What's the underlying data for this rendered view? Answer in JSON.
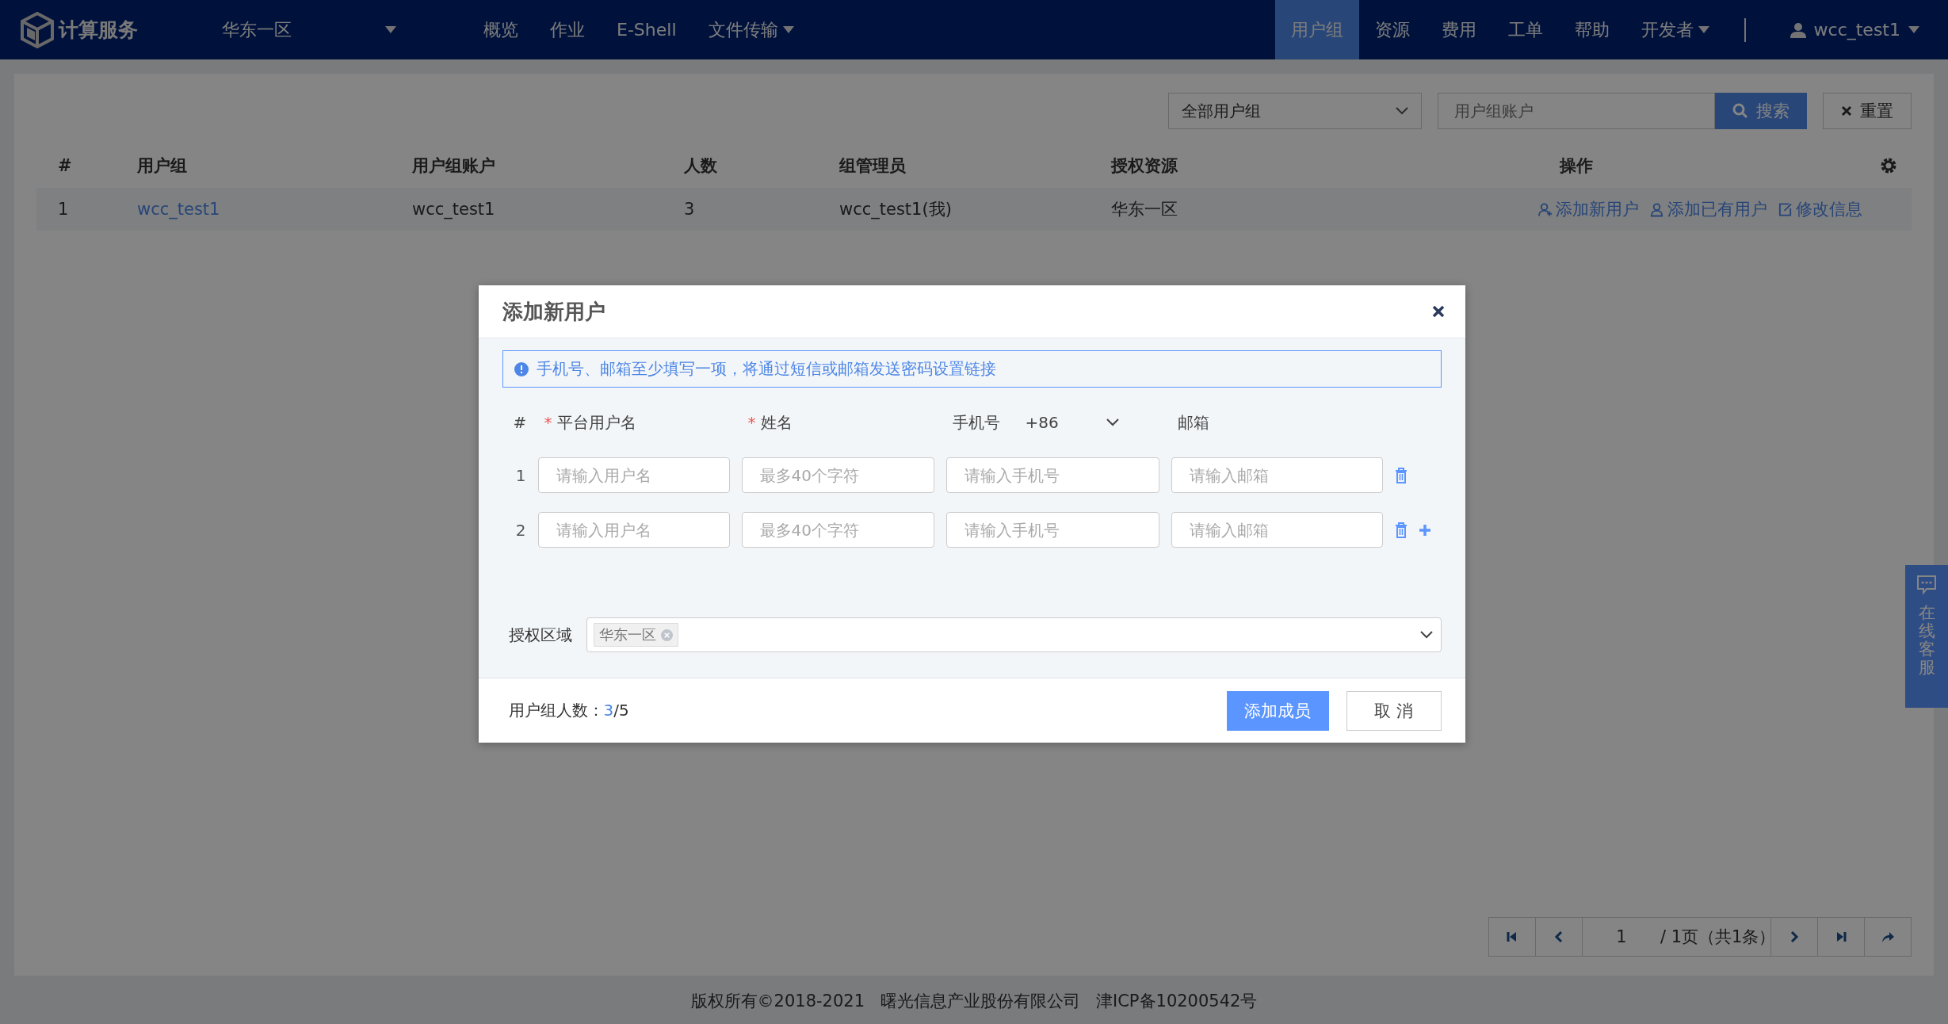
{
  "navbar": {
    "logo_text": "计算服务",
    "region": "华东一区",
    "menu": [
      {
        "label": "概览",
        "selected": false,
        "dropdown": false
      },
      {
        "label": "作业",
        "selected": false,
        "dropdown": false
      },
      {
        "label": "E-Shell",
        "selected": false,
        "dropdown": false
      },
      {
        "label": "文件传输",
        "selected": false,
        "dropdown": true
      },
      {
        "label": "用户组",
        "selected": true,
        "dropdown": false
      },
      {
        "label": "资源",
        "selected": false,
        "dropdown": false
      },
      {
        "label": "费用",
        "selected": false,
        "dropdown": false
      },
      {
        "label": "工单",
        "selected": false,
        "dropdown": false
      },
      {
        "label": "帮助",
        "selected": false,
        "dropdown": false
      },
      {
        "label": "开发者",
        "selected": false,
        "dropdown": true
      }
    ],
    "user": "wcc_test1"
  },
  "toolbar": {
    "group_filter": "全部用户组",
    "search_placeholder": "用户组账户",
    "search_button": "搜索",
    "reset_button": "重置"
  },
  "table": {
    "columns": [
      "#",
      "用户组",
      "用户组账户",
      "人数",
      "组管理员",
      "授权资源",
      "操作"
    ],
    "rows": [
      {
        "cells": [
          "1",
          "wcc_test1",
          "wcc_test1",
          "3",
          "wcc_test1(我)",
          "华东一区"
        ],
        "actions": [
          "添加新用户",
          "添加已有用户",
          "修改信息"
        ]
      }
    ]
  },
  "pagination": {
    "page": "1",
    "info": "/ 1页（共1条）"
  },
  "footer": [
    "版权所有©2018-2021",
    "曙光信息产业股份有限公司",
    "津ICP备10200542号"
  ],
  "chat_tab": {
    "label": "在线客服"
  },
  "dialog": {
    "title": "添加新用户",
    "notice": "手机号、邮箱至少填写一项，将通过短信或邮箱发送密码设置链接",
    "columns": [
      {
        "kind": "index",
        "label": "#",
        "required": false
      },
      {
        "kind": "text",
        "label": "平台用户名",
        "required": true
      },
      {
        "kind": "text",
        "label": "姓名",
        "required": true
      },
      {
        "kind": "phone",
        "label": "手机号",
        "required": false,
        "country_code": "+86"
      },
      {
        "kind": "text",
        "label": "邮箱",
        "required": false
      }
    ],
    "rows": [
      {
        "index": "1",
        "placeholders": [
          "请输入用户名",
          "最多40个字符",
          "请输入手机号",
          "请输入邮箱"
        ],
        "can_add": false
      },
      {
        "index": "2",
        "placeholders": [
          "请输入用户名",
          "最多40个字符",
          "请输入手机号",
          "请输入邮箱"
        ],
        "can_add": true
      }
    ],
    "required_mark": "*",
    "region_label": "授权区域",
    "region_tags": [
      "华东一区"
    ],
    "count_label": "用户组人数：",
    "count_current": "3",
    "count_total": "/5",
    "confirm_button": "添加成员",
    "cancel_button": "取 消"
  }
}
